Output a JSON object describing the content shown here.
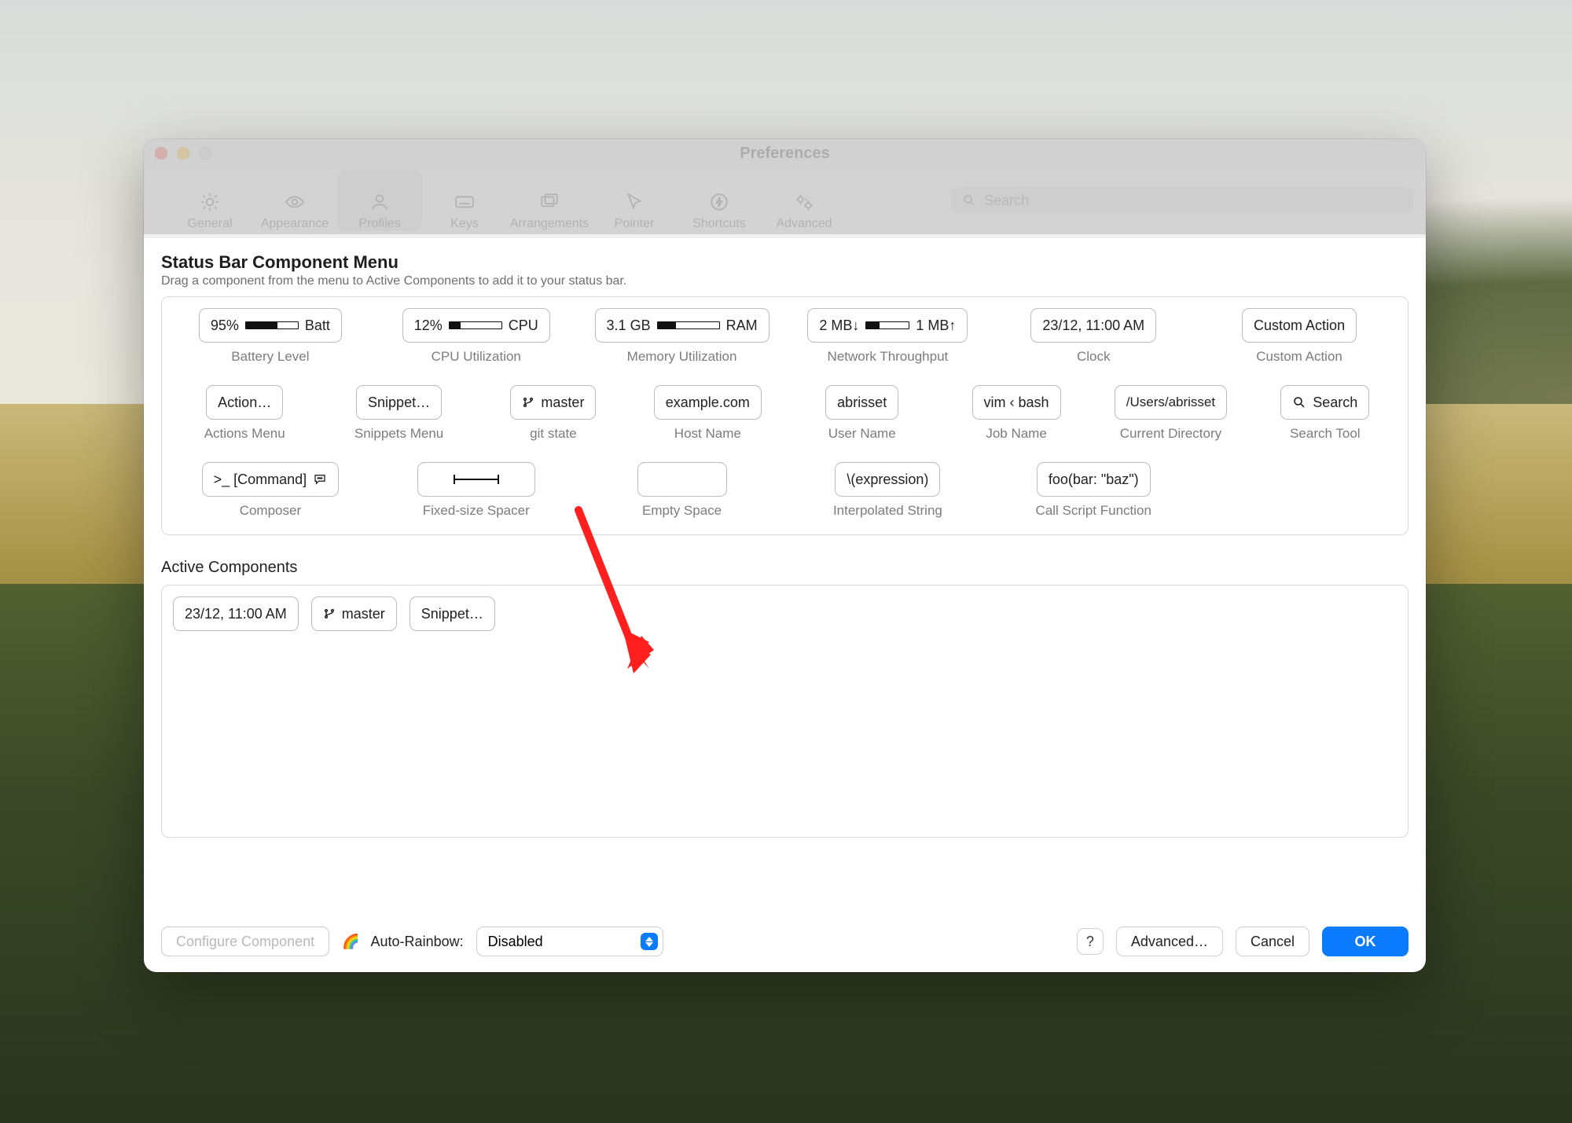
{
  "window": {
    "title": "Preferences",
    "search_placeholder": "Search",
    "toolbar_search_caption": "Search",
    "tabs": [
      {
        "id": "general",
        "label": "General"
      },
      {
        "id": "appearance",
        "label": "Appearance"
      },
      {
        "id": "profiles",
        "label": "Profiles"
      },
      {
        "id": "keys",
        "label": "Keys"
      },
      {
        "id": "arrangements",
        "label": "Arrangements"
      },
      {
        "id": "pointer",
        "label": "Pointer"
      },
      {
        "id": "shortcuts",
        "label": "Shortcuts"
      },
      {
        "id": "advanced",
        "label": "Advanced"
      }
    ],
    "active_tab": "profiles"
  },
  "menu": {
    "heading": "Status Bar Component Menu",
    "hint": "Drag a component from the menu to Active Components to add it to your status bar.",
    "row1": [
      {
        "id": "battery",
        "pill_left": "95%",
        "pill_right": "Batt",
        "caption": "Battery Level"
      },
      {
        "id": "cpu",
        "pill_left": "12%",
        "pill_right": "CPU",
        "caption": "CPU Utilization"
      },
      {
        "id": "ram",
        "pill_left": "3.1 GB",
        "pill_right": "RAM",
        "caption": "Memory Utilization"
      },
      {
        "id": "net",
        "pill_left": "2 MB↓",
        "pill_right": "1 MB↑",
        "caption": "Network Throughput"
      },
      {
        "id": "clock",
        "pill": "23/12, 11:00 AM",
        "caption": "Clock"
      },
      {
        "id": "custom",
        "pill": "Custom Action",
        "caption": "Custom Action"
      }
    ],
    "row2": [
      {
        "id": "actions",
        "pill": "Action…",
        "caption": "Actions Menu"
      },
      {
        "id": "snippets",
        "pill": "Snippet…",
        "caption": "Snippets Menu"
      },
      {
        "id": "git",
        "pill": "master",
        "caption": "git state"
      },
      {
        "id": "host",
        "pill": "example.com",
        "caption": "Host Name"
      },
      {
        "id": "user",
        "pill": "abrisset",
        "caption": "User Name"
      },
      {
        "id": "job",
        "pill": "vim ‹ bash",
        "caption": "Job Name"
      },
      {
        "id": "cwd",
        "pill": "/Users/abrisset",
        "caption": "Current Directory"
      },
      {
        "id": "search",
        "pill": "Search",
        "caption": "Search Tool"
      }
    ],
    "row3": [
      {
        "id": "composer",
        "pill": ">_ [Command]",
        "caption": "Composer"
      },
      {
        "id": "spacer",
        "pill": "",
        "caption": "Fixed-size Spacer"
      },
      {
        "id": "empty",
        "pill": "",
        "caption": "Empty Space"
      },
      {
        "id": "interp",
        "pill": "\\(expression)",
        "caption": "Interpolated String"
      },
      {
        "id": "script",
        "pill": "foo(bar: \"baz\")",
        "caption": "Call Script Function"
      }
    ]
  },
  "active": {
    "heading": "Active Components",
    "items": [
      {
        "id": "clock",
        "label": "23/12, 11:00 AM"
      },
      {
        "id": "git",
        "label": "master"
      },
      {
        "id": "snippets",
        "label": "Snippet…"
      }
    ]
  },
  "footer": {
    "configure": "Configure Component",
    "auto_rainbow_label": "Auto-Rainbow:",
    "auto_rainbow_value": "Disabled",
    "help": "?",
    "advanced": "Advanced…",
    "cancel": "Cancel",
    "ok": "OK"
  }
}
